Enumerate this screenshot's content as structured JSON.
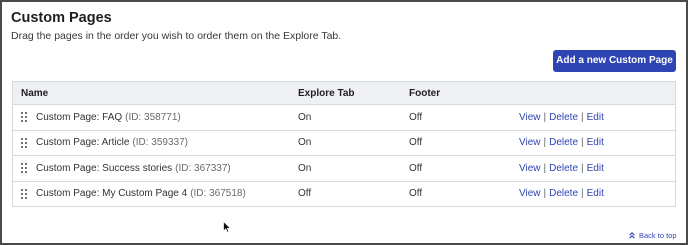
{
  "header": {
    "title": "Custom Pages",
    "description": "Drag the pages in the order you wish to order them on the Explore Tab.",
    "add_button_label": "Add a new Custom Page"
  },
  "table": {
    "columns": [
      "Name",
      "Explore Tab",
      "Footer"
    ],
    "rows": [
      {
        "name": "Custom Page: FAQ",
        "id": "(ID: 358771)",
        "explore": "On",
        "footer": "Off",
        "view": "View",
        "delete": "Delete",
        "edit": "Edit"
      },
      {
        "name": "Custom Page: Article",
        "id": "(ID: 359337)",
        "explore": "On",
        "footer": "Off",
        "view": "View",
        "delete": "Delete",
        "edit": "Edit"
      },
      {
        "name": "Custom Page: Success stories",
        "id": "(ID: 367337)",
        "explore": "On",
        "footer": "Off",
        "view": "View",
        "delete": "Delete",
        "edit": "Edit"
      },
      {
        "name": "Custom Page: My Custom Page 4",
        "id": "(ID: 367518)",
        "explore": "Off",
        "footer": "Off",
        "view": "View",
        "delete": "Delete",
        "edit": "Edit"
      }
    ]
  },
  "footer": {
    "back_to_top": "Back to top"
  },
  "colors": {
    "accent": "#2f44b3",
    "header_bg": "#eef0f3",
    "border": "#d6d9de"
  },
  "icons": {
    "drag_handle": "drag-handle-icon",
    "back_to_top": "double-chevron-up-icon",
    "cursor": "mouse-pointer-icon"
  }
}
